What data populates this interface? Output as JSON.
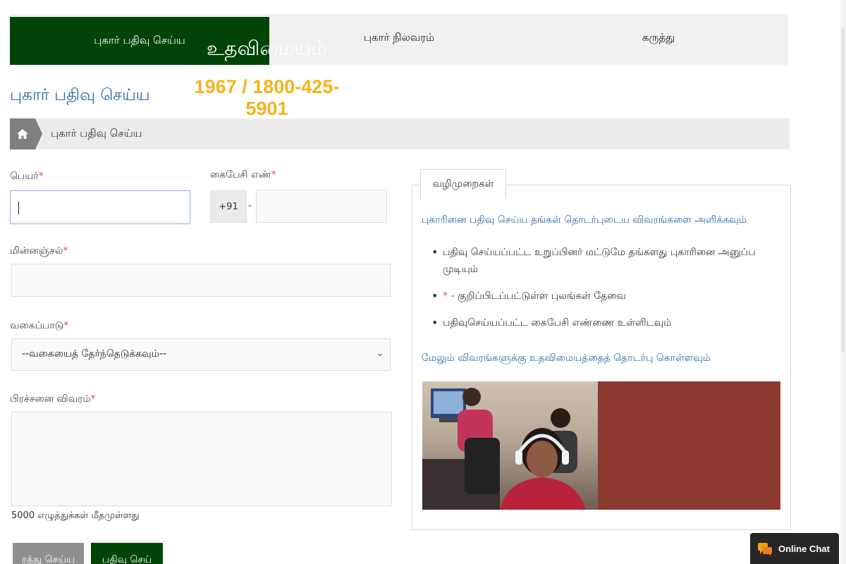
{
  "tabs": [
    {
      "label": "புகார் பதிவு செய்ய",
      "active": true
    },
    {
      "label": "புகார் நிலவரம்",
      "active": false
    },
    {
      "label": "கருத்து",
      "active": false
    }
  ],
  "page_title": "புகார் பதிவு செய்ய",
  "breadcrumb": {
    "icon": "home-icon",
    "current": "புகார் பதிவு செய்ய"
  },
  "form": {
    "required_marker": "*",
    "name": {
      "label": "பெயர்",
      "value": ""
    },
    "mobile": {
      "label": "கைபேசி எண்",
      "prefix": "+91",
      "separator": "-",
      "value": ""
    },
    "email": {
      "label": "மின்னஞ்சல்",
      "value": ""
    },
    "category": {
      "label": "வகைப்பாடு",
      "selected": "--வகையைத் தேர்ந்தெடுக்கவும்--"
    },
    "details": {
      "label": "பிரச்சனை விவரம்",
      "char_note": "5000 எழுத்துக்கள் மீதமுள்ளது"
    },
    "cancel_label": "ரத்து செய்ய",
    "submit_label": "பதிவு செய்"
  },
  "guidelines": {
    "title": "வழிமுறைகள்",
    "heading": "புகாரினை பதிவு செய்ய தங்கள் தொடர்புடைய விவரங்களை அளிக்கவும்",
    "items": [
      "பதிவு செய்யப்பட்ட உறுப்பினர் மட்டுமே தங்களது புகாரினை அனுப்ப முடியும்",
      "குறிப்பிடப்பட்டுள்ள புலங்கள் தேவை"
    ],
    "item_star_prefix": "* -",
    "item_last": "பதிவுசெய்யப்பட்ட கைபேசி எண்ணை உள்ளிடவும்",
    "contact_note": "மேலும் விவரங்களுக்கு உதவிமையத்தைத் தொடர்பு கொள்ளவும்"
  },
  "helpline": {
    "title": "உதவிமையம்",
    "numbers": "1967 / 1800-425-5901"
  },
  "chat": {
    "label": "Online Chat"
  },
  "colors": {
    "primary_green": "#004408",
    "link_blue": "#2c6aa7",
    "required_red": "#d9534f",
    "banner_red": "#8c3a30",
    "helpline_yellow": "#f3b41b"
  }
}
